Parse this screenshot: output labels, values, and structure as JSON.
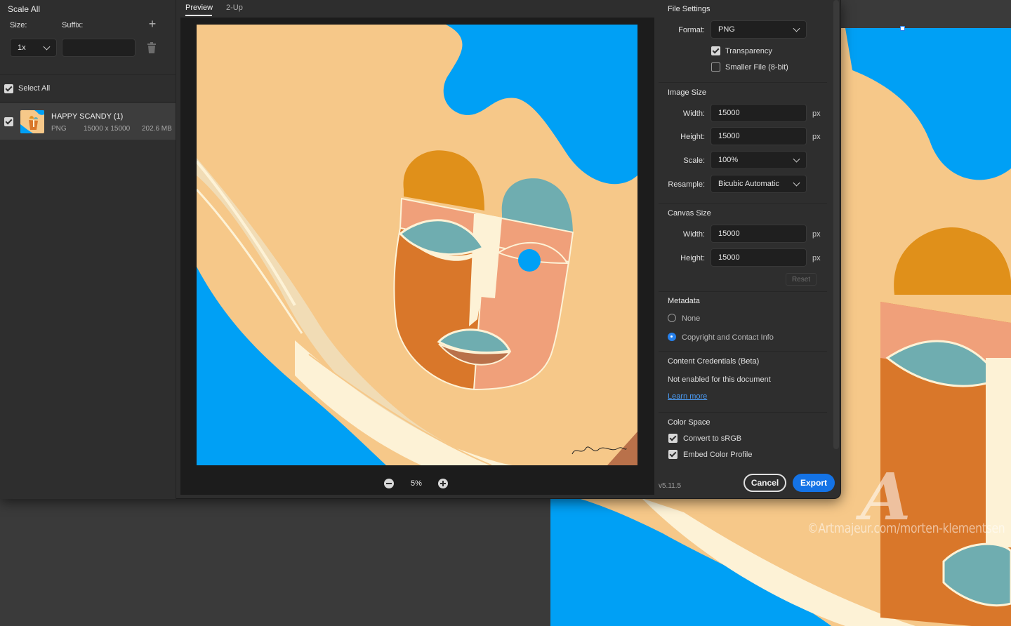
{
  "left_panel": {
    "title": "Scale All",
    "size_label": "Size:",
    "suffix_label": "Suffix:",
    "size_value": "1x",
    "suffix_value": "",
    "select_all_label": "Select All",
    "asset": {
      "name": "HAPPY SCANDY (1)",
      "format": "PNG",
      "dimensions": "15000 x 15000",
      "file_size": "202.6 MB"
    }
  },
  "center": {
    "tabs": [
      {
        "label": "Preview"
      },
      {
        "label": "2-Up"
      }
    ],
    "zoom_level": "5%"
  },
  "right_panel": {
    "file_settings": {
      "title": "File Settings",
      "format_label": "Format:",
      "format_value": "PNG",
      "transparency_label": "Transparency",
      "smaller_file_label": "Smaller File (8-bit)"
    },
    "image_size": {
      "title": "Image Size",
      "width_label": "Width:",
      "width_value": "15000",
      "height_label": "Height:",
      "height_value": "15000",
      "scale_label": "Scale:",
      "scale_value": "100%",
      "resample_label": "Resample:",
      "resample_value": "Bicubic Automatic",
      "unit": "px"
    },
    "canvas_size": {
      "title": "Canvas Size",
      "width_label": "Width:",
      "width_value": "15000",
      "height_label": "Height:",
      "height_value": "15000",
      "unit": "px",
      "reset_label": "Reset"
    },
    "metadata": {
      "title": "Metadata",
      "none_label": "None",
      "copyright_label": "Copyright and Contact Info"
    },
    "content_credentials": {
      "title": "Content Credentials (Beta)",
      "status": "Not enabled for this document",
      "learn_more": "Learn more"
    },
    "color_space": {
      "title": "Color Space",
      "convert_label": "Convert to sRGB",
      "embed_label": "Embed Color Profile"
    },
    "version": "v5.11.5",
    "cancel_label": "Cancel",
    "export_label": "Export"
  },
  "background": {
    "watermark": "©Artmajeur.com/morten-klementsen",
    "watermark_logo": "A"
  },
  "colors": {
    "accent_blue": "#1473e6",
    "art_blue": "#00a0f5",
    "art_sand": "#f6c889"
  }
}
